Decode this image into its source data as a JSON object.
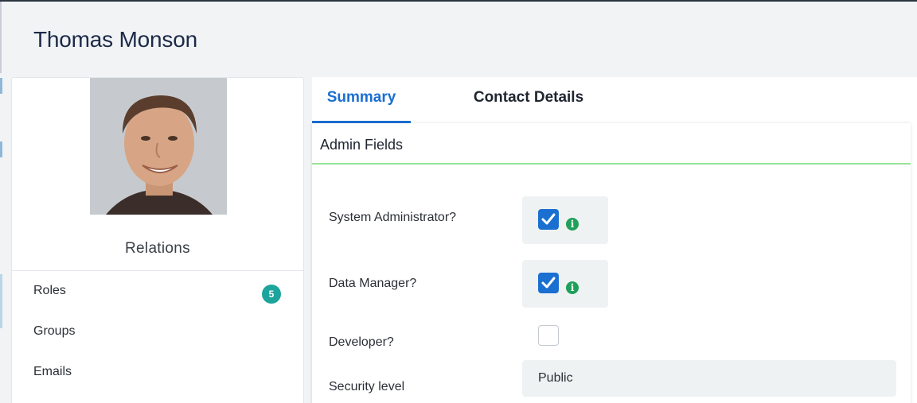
{
  "page": {
    "title": "Thomas Monson"
  },
  "profile": {
    "avatar": "user-photo"
  },
  "relations": {
    "title": "Relations",
    "items": [
      {
        "label": "Roles",
        "count": "5"
      },
      {
        "label": "Groups"
      },
      {
        "label": "Emails"
      }
    ]
  },
  "tabs": [
    {
      "label": "Summary",
      "active": true
    },
    {
      "label": "Contact Details",
      "active": false
    }
  ],
  "admin_fields": {
    "title": "Admin Fields",
    "system_admin": {
      "label": "System Administrator?",
      "checked": true,
      "info_icon": "info-icon"
    },
    "data_manager": {
      "label": "Data Manager?",
      "checked": true,
      "info_icon": "info-icon"
    },
    "developer": {
      "label": "Developer?",
      "checked": false
    },
    "security_level": {
      "label": "Security level",
      "value": "Public"
    }
  },
  "colors": {
    "accent": "#1a6fd1",
    "badge": "#1da59c",
    "info": "#1ea05a",
    "card_header_border": "#98e39a"
  }
}
